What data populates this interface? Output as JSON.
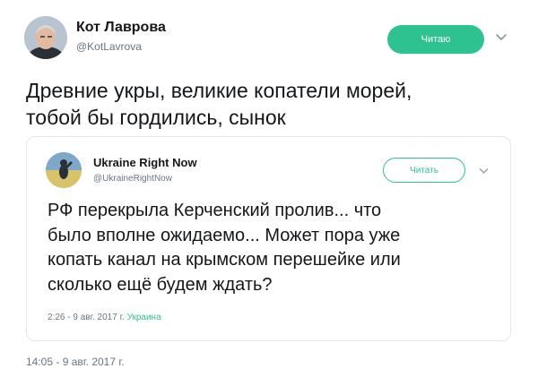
{
  "tweet": {
    "author_name": "Кот Лаврова",
    "author_handle": "@KotLavrova",
    "follow_label": "Читаю",
    "text": "Древние укры, великие копатели морей,\nтобой бы гордились, сынок",
    "timestamp": "14:05 - 9 авг. 2017 г."
  },
  "quoted_tweet": {
    "author_name": "Ukraine Right Now",
    "author_handle": "@UkraineRightNow",
    "follow_label": "Читать",
    "text": "РФ перекрыла Керченский пролив... что\nбыло вполне ожидаемо... Может пора уже\nкопать канал на крымском перешейке или\nсколько ещё будем ждать?",
    "timestamp": "2:26 - 9 авг. 2017 г.",
    "location": "Украина"
  },
  "colors": {
    "accent": "#2fc291",
    "text": "#14171a",
    "secondary": "#657786",
    "border": "#e1e8ed"
  },
  "icons": {
    "caret": "chevron-down-icon",
    "avatar": "user-avatar",
    "quoted_avatar": "quoted-user-avatar"
  }
}
